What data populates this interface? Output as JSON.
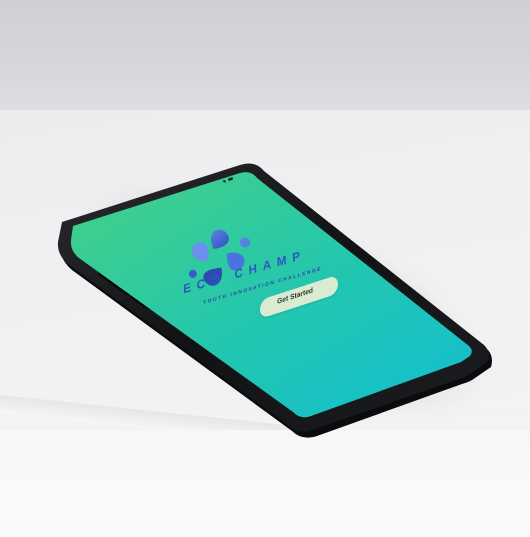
{
  "app": {
    "brand_name": "ECO CHAMP",
    "tagline": "YOUTH INNOVATION CHALLENGE",
    "cta_label": "Get Started"
  },
  "colors": {
    "screen_gradient_start": "#3fd08a",
    "screen_gradient_end": "#15c0cf",
    "logo_blue": "#3a5fc9",
    "cta_background": "#d9ecd1",
    "phone_body": "#111214"
  },
  "icons": {
    "logo": "pinwheel-logo-icon"
  }
}
